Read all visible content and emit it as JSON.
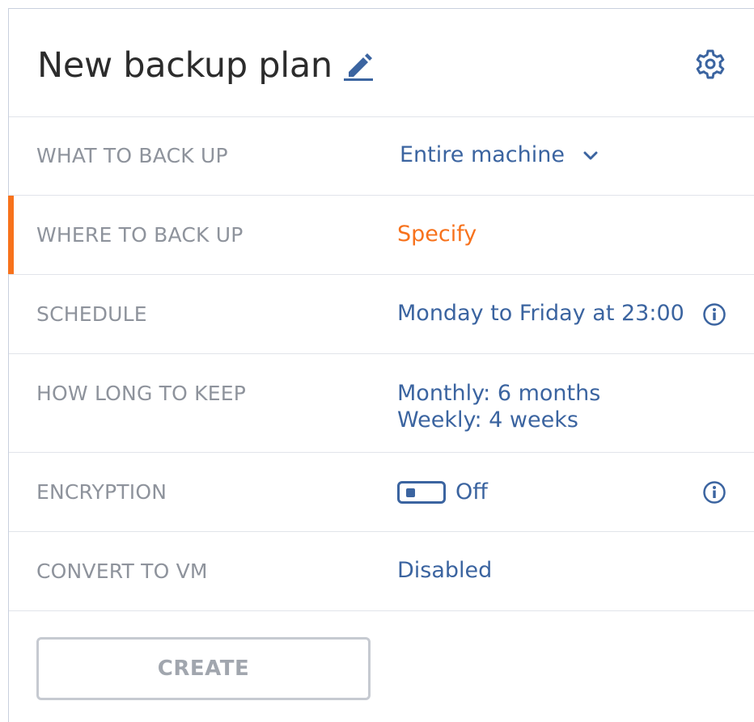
{
  "header": {
    "title": "New backup plan"
  },
  "rows": {
    "what": {
      "label": "WHAT TO BACK UP",
      "value": "Entire machine"
    },
    "where": {
      "label": "WHERE TO BACK UP",
      "value": "Specify"
    },
    "schedule": {
      "label": "SCHEDULE",
      "value": "Monday to Friday at 23:00"
    },
    "keep": {
      "label": "HOW LONG TO KEEP",
      "line1": "Monthly: 6 months",
      "line2": "Weekly: 4 weeks"
    },
    "encryption": {
      "label": "ENCRYPTION",
      "state": "Off"
    },
    "convert": {
      "label": "CONVERT TO VM",
      "value": "Disabled"
    }
  },
  "actions": {
    "create_label": "CREATE"
  },
  "colors": {
    "accent": "#f7721c",
    "link": "#3b64a0",
    "label": "#8e939c",
    "disabled": "#a1a6ae"
  },
  "icons": {
    "edit": "pencil-icon",
    "settings": "gear-icon",
    "dropdown": "chevron-down-icon",
    "info": "info-icon"
  }
}
